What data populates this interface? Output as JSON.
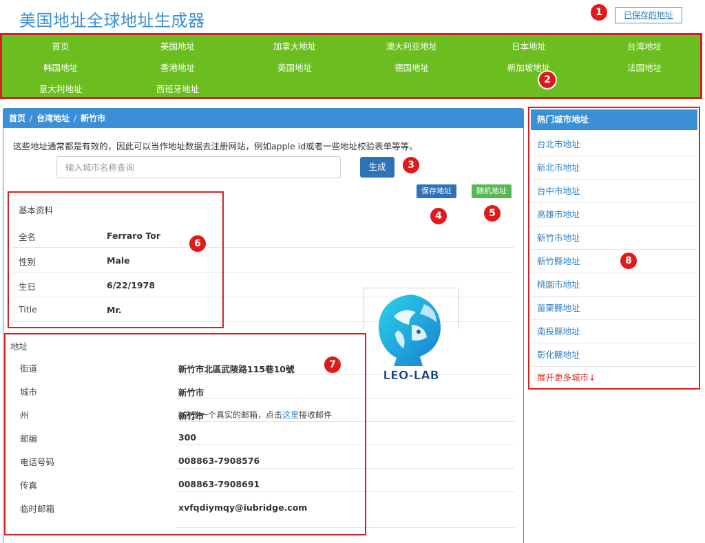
{
  "header": {
    "title": "美国地址全球地址生成器",
    "saved_label": "已保存的地址"
  },
  "nav": {
    "items": [
      "首页",
      "美国地址",
      "加拿大地址",
      "澳大利亚地址",
      "日本地址",
      "台湾地址",
      "韩国地址",
      "香港地址",
      "英国地址",
      "德国地址",
      "新加坡地址",
      "法国地址",
      "意大利地址",
      "西班牙地址"
    ]
  },
  "breadcrumb": {
    "home": "首页",
    "region": "台湾地址",
    "city": "新竹市",
    "sep": "/"
  },
  "intro": "这些地址通常都是有效的，因此可以当作地址数据去注册网站，例如apple id或者一些地址校验表单等等。",
  "search": {
    "placeholder": "输入城市名称查询",
    "button": "生成"
  },
  "actions": {
    "save": "保存地址",
    "random": "随机地址"
  },
  "basic": {
    "title": "基本资料",
    "rows": [
      {
        "label": "全名",
        "value": "Ferraro Tor"
      },
      {
        "label": "性别",
        "value": "Male"
      },
      {
        "label": "生日",
        "value": "6/22/1978"
      },
      {
        "label": "Title",
        "value": "Mr."
      }
    ]
  },
  "address": {
    "title": "地址",
    "rows": [
      {
        "label": "街道",
        "value": "新竹市北區武陵路115巷10號"
      },
      {
        "label": "城市",
        "value": "新竹市"
      },
      {
        "label": "州",
        "value": "新竹市"
      },
      {
        "label": "邮编",
        "value": "300"
      },
      {
        "label": "电话号码",
        "value": "008863-7908576"
      },
      {
        "label": "传真",
        "value": "008863-7908691"
      },
      {
        "label": "临时邮箱",
        "value": "xvfqdiymqy@iubridge.com"
      }
    ],
    "email_note_prefix": "这是一个真实的邮箱，点击",
    "email_note_link": "这里",
    "email_note_suffix": "接收邮件"
  },
  "logo": {
    "text": "LEO-LAB",
    "color": "#1aa6d8"
  },
  "sidebar": {
    "title": "热门城市地址",
    "items": [
      "台北市地址",
      "新北市地址",
      "台中市地址",
      "高雄市地址",
      "新竹市地址",
      "新竹縣地址",
      "桃園市地址",
      "苗栗縣地址",
      "南投縣地址",
      "彰化縣地址"
    ],
    "more": "展开更多城市↓"
  },
  "annotations": [
    "1",
    "2",
    "3",
    "4",
    "5",
    "6",
    "7",
    "8"
  ],
  "colors": {
    "accent": "#3a8fd6",
    "nav_bg": "#6cbd1f",
    "annotation": "#e01a1a",
    "primary_btn": "#2f72b8",
    "success_btn": "#55b855"
  }
}
